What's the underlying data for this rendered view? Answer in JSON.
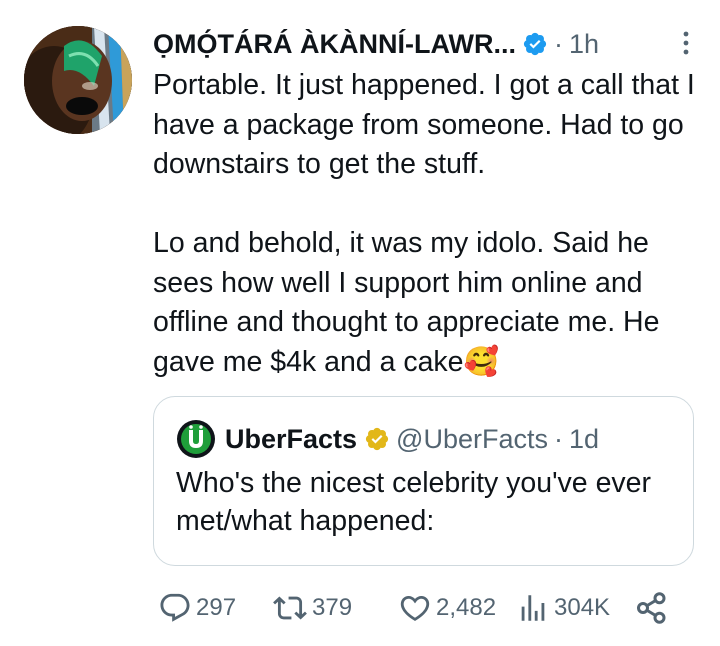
{
  "tweet": {
    "display_name": "ỌMỌ́TÁRÁ ÀKÀNNÍ-LAWR...",
    "dot": "·",
    "time": "1h",
    "text": "Portable. It just happened. I got a call that I have a package from someone. Had to go downstairs to get the stuff.\n\nLo and behold, it was my idolo. Said he sees how well I support him online and offline and thought to appreciate me. He gave me $4k and a cake🥰"
  },
  "quote": {
    "name": "UberFacts",
    "handle": "@UberFacts",
    "dot": "·",
    "time": "1d",
    "text": "Who's the nicest celebrity you've ever met/what happened:"
  },
  "actions": {
    "replies": "297",
    "reposts": "379",
    "likes": "2,482",
    "views": "304K"
  },
  "colors": {
    "text": "#0f1419",
    "muted": "#536471",
    "verified_blue": "#1d9bf0",
    "verified_gold": "#e2b719",
    "border": "#cfd9de",
    "uberfacts_green": "#1f9e3a"
  },
  "icons": {
    "verified": "blue-check-badge-icon",
    "quote_verified": "gold-check-badge-icon",
    "more": "vertical-dots-icon",
    "reply": "speech-bubble-icon",
    "repost": "repost-arrows-icon",
    "like": "heart-icon",
    "views": "bar-chart-icon",
    "share": "share-nodes-icon"
  }
}
